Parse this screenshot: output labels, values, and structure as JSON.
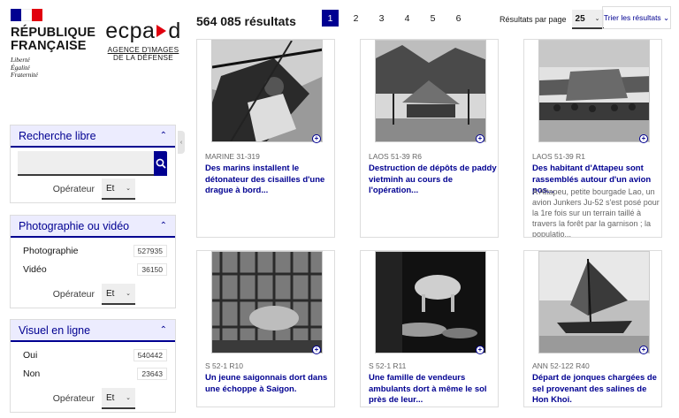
{
  "header": {
    "gov_title": "RÉPUBLIQUE FRANÇAISE",
    "gov_motto": [
      "Liberté",
      "Égalité",
      "Fraternité"
    ],
    "flag_colors": [
      "#000091",
      "#ffffff",
      "#e1000f"
    ],
    "agency_logo": {
      "left": "ecpa",
      "right": "d",
      "sub_line1": "AGENCE D'IMAGES",
      "sub_line2": "DE LA DÉFENSE",
      "accent": "#e1000f"
    }
  },
  "sidebar": {
    "free_search": {
      "title": "Recherche libre",
      "input_value": "",
      "operator_label": "Opérateur",
      "operator_value": "Et"
    },
    "media_type": {
      "title": "Photographie ou vidéo",
      "options": [
        {
          "label": "Photographie",
          "count": "527935"
        },
        {
          "label": "Vidéo",
          "count": "36150"
        }
      ],
      "operator_label": "Opérateur",
      "operator_value": "Et"
    },
    "online_visual": {
      "title": "Visuel en ligne",
      "options": [
        {
          "label": "Oui",
          "count": "540442"
        },
        {
          "label": "Non",
          "count": "23643"
        }
      ],
      "operator_label": "Opérateur",
      "operator_value": "Et"
    }
  },
  "topbar": {
    "results_count": "564 085 résultats",
    "pages": [
      "1",
      "2",
      "3",
      "4",
      "5",
      "6"
    ],
    "active_page": "1",
    "per_page_label": "Résultats par page",
    "per_page_value": "25",
    "sort_label": "Trier les résultats ⌄"
  },
  "theme": {
    "primary": "#000091",
    "panel_header_bg": "#ececfe"
  },
  "cards": [
    {
      "ref": "MARINE 31-319",
      "title": "Des marins installent le détonateur des cisailles d'une drague à bord...",
      "desc": ""
    },
    {
      "ref": "LAOS 51-39 R6",
      "title": "Destruction de dépôts de paddy vietminh au cours de l'opération...",
      "desc": ""
    },
    {
      "ref": "LAOS 51-39 R1",
      "title": "Des habitant d'Attapeu sont rassemblés autour d'un avion pos...",
      "desc": "A Attapeu, petite bourgade Lao, un avion Junkers Ju-52 s'est posé pour la 1re fois sur un terrain taillé à travers la forêt par la garnison ; la populatio..."
    },
    {
      "ref": "S 52-1 R10",
      "title": "Un jeune saigonnais dort dans une échoppe à Saigon.",
      "desc": ""
    },
    {
      "ref": "S 52-1 R11",
      "title": "Une famille de vendeurs ambulants dort à même le sol près de leur...",
      "desc": ""
    },
    {
      "ref": "ANN 52-122 R40",
      "title": "Départ de jonques chargées de sel provenant des salines de Hon Khoi.",
      "desc": ""
    }
  ]
}
